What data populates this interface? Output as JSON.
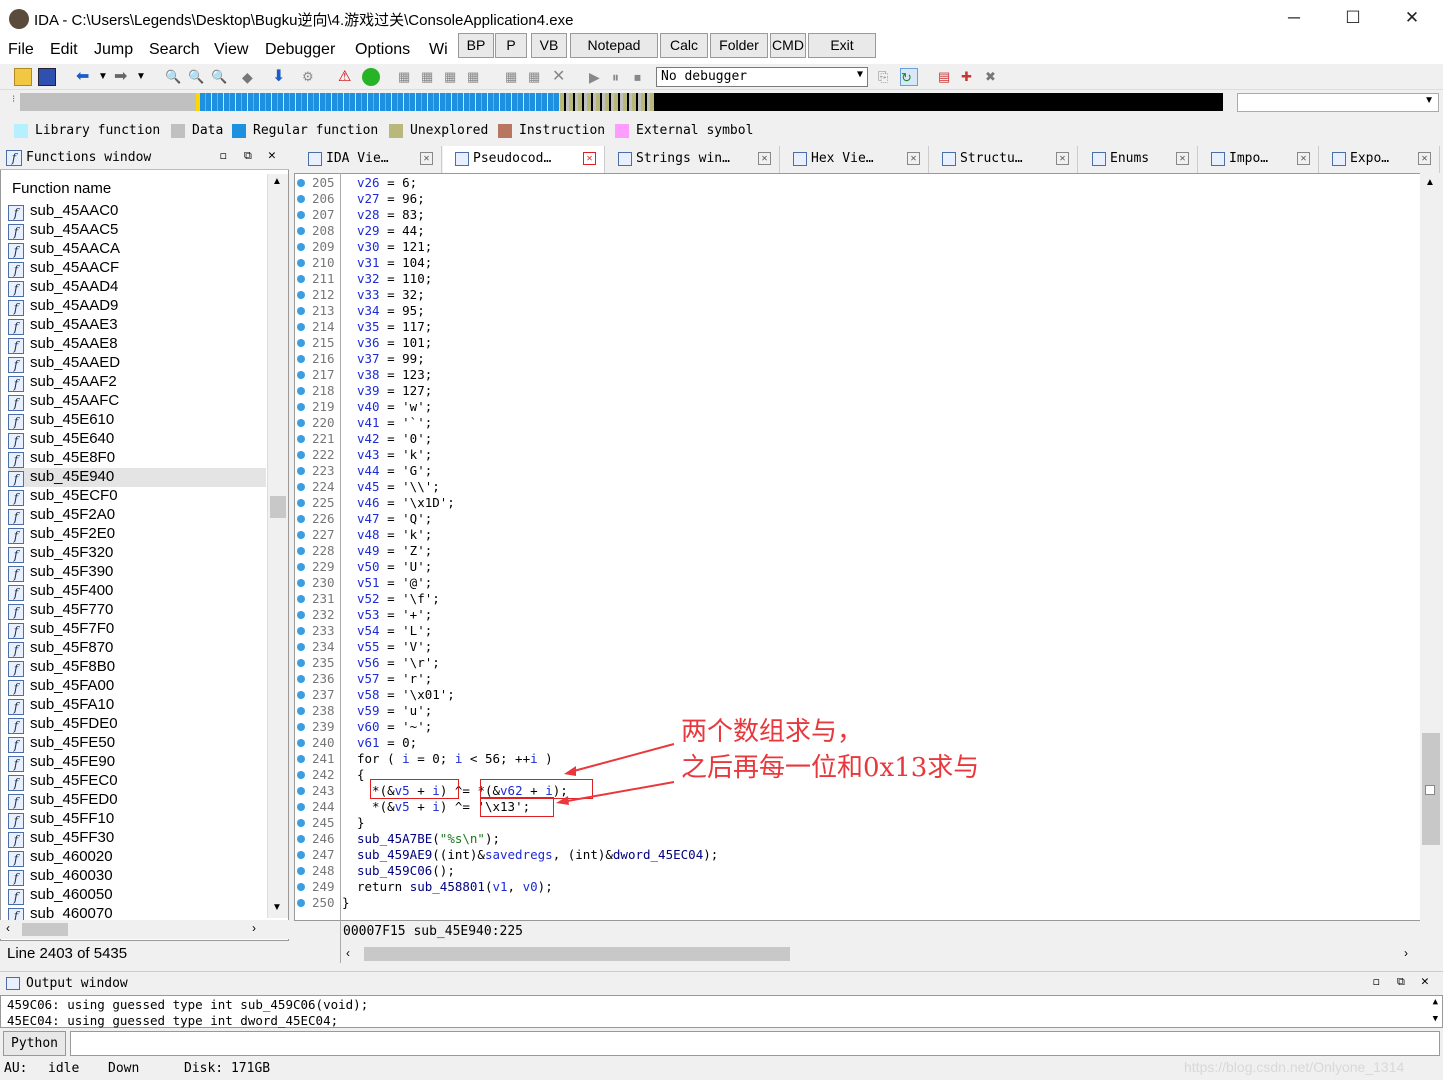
{
  "window": {
    "title": "IDA - C:\\Users\\Legends\\Desktop\\Bugku逆向\\4.游戏过关\\ConsoleApplication4.exe",
    "min": "─",
    "max": "☐",
    "close": "✕"
  },
  "menu": [
    "File",
    "Edit",
    "Jump",
    "Search",
    "View",
    "Debugger",
    "Options",
    "Wi"
  ],
  "quick_buttons": [
    "BP",
    "P",
    "VB",
    "Notepad",
    "Calc",
    "Folder",
    "CMD",
    "Exit"
  ],
  "debugger_select": "No debugger",
  "legend": [
    {
      "label": "Library function",
      "color": "#b6f0ff"
    },
    {
      "label": "Data",
      "color": "#c0c0c0"
    },
    {
      "label": "Regular function",
      "color": "#1e90e0"
    },
    {
      "label": "Unexplored",
      "color": "#b8b87a"
    },
    {
      "label": "Instruction",
      "color": "#b87560"
    },
    {
      "label": "External symbol",
      "color": "#ff9cff"
    }
  ],
  "functions_window": {
    "title": "Functions window",
    "column": "Function name",
    "items": [
      "sub_45AAC0",
      "sub_45AAC5",
      "sub_45AACA",
      "sub_45AACF",
      "sub_45AAD4",
      "sub_45AAD9",
      "sub_45AAE3",
      "sub_45AAE8",
      "sub_45AAED",
      "sub_45AAF2",
      "sub_45AAFC",
      "sub_45E610",
      "sub_45E640",
      "sub_45E8F0",
      "sub_45E940",
      "sub_45ECF0",
      "sub_45F2A0",
      "sub_45F2E0",
      "sub_45F320",
      "sub_45F390",
      "sub_45F400",
      "sub_45F770",
      "sub_45F7F0",
      "sub_45F870",
      "sub_45F8B0",
      "sub_45FA00",
      "sub_45FA10",
      "sub_45FDE0",
      "sub_45FE50",
      "sub_45FE90",
      "sub_45FEC0",
      "sub_45FED0",
      "sub_45FF10",
      "sub_45FF30",
      "sub_460020",
      "sub_460030",
      "sub_460050",
      "sub_460070"
    ],
    "selected": "sub_45E940",
    "line_status": "Line 2403 of 5435"
  },
  "tabs": [
    {
      "label": "IDA Vie…",
      "icon": "ida-view-icon"
    },
    {
      "label": "Pseudocod…",
      "icon": "pseudocode-icon",
      "active": true
    },
    {
      "label": "Strings win…",
      "icon": "strings-icon"
    },
    {
      "label": "Hex Vie…",
      "icon": "hex-icon"
    },
    {
      "label": "Structu…",
      "icon": "struct-icon"
    },
    {
      "label": "Enums",
      "icon": "enums-icon"
    },
    {
      "label": "Impo…",
      "icon": "imports-icon"
    },
    {
      "label": "Expo…",
      "icon": "exports-icon"
    }
  ],
  "code": [
    {
      "n": "205",
      "t": "v26 = 6;"
    },
    {
      "n": "206",
      "t": "v27 = 96;"
    },
    {
      "n": "207",
      "t": "v28 = 83;"
    },
    {
      "n": "208",
      "t": "v29 = 44;"
    },
    {
      "n": "209",
      "t": "v30 = 121;"
    },
    {
      "n": "210",
      "t": "v31 = 104;"
    },
    {
      "n": "211",
      "t": "v32 = 110;"
    },
    {
      "n": "212",
      "t": "v33 = 32;"
    },
    {
      "n": "213",
      "t": "v34 = 95;"
    },
    {
      "n": "214",
      "t": "v35 = 117;"
    },
    {
      "n": "215",
      "t": "v36 = 101;"
    },
    {
      "n": "216",
      "t": "v37 = 99;"
    },
    {
      "n": "217",
      "t": "v38 = 123;"
    },
    {
      "n": "218",
      "t": "v39 = 127;"
    },
    {
      "n": "219",
      "t": "v40 = 'w';"
    },
    {
      "n": "220",
      "t": "v41 = '`';"
    },
    {
      "n": "221",
      "t": "v42 = '0';"
    },
    {
      "n": "222",
      "t": "v43 = 'k';"
    },
    {
      "n": "223",
      "t": "v44 = 'G';"
    },
    {
      "n": "224",
      "t": "v45 = '\\\\';"
    },
    {
      "n": "225",
      "t": "v46 = '\\x1D';"
    },
    {
      "n": "226",
      "t": "v47 = 'Q';"
    },
    {
      "n": "227",
      "t": "v48 = 'k';"
    },
    {
      "n": "228",
      "t": "v49 = 'Z';"
    },
    {
      "n": "229",
      "t": "v50 = 'U';"
    },
    {
      "n": "230",
      "t": "v51 = '@';"
    },
    {
      "n": "231",
      "t": "v52 = '\\f';"
    },
    {
      "n": "232",
      "t": "v53 = '+';"
    },
    {
      "n": "233",
      "t": "v54 = 'L';"
    },
    {
      "n": "234",
      "t": "v55 = 'V';"
    },
    {
      "n": "235",
      "t": "v56 = '\\r';"
    },
    {
      "n": "236",
      "t": "v57 = 'r';"
    },
    {
      "n": "237",
      "t": "v58 = '\\x01';"
    },
    {
      "n": "238",
      "t": "v59 = 'u';"
    },
    {
      "n": "239",
      "t": "v60 = '~';"
    },
    {
      "n": "240",
      "t": "v61 = 0;"
    },
    {
      "n": "241",
      "t": "for ( i = 0; i < 56; ++i )"
    },
    {
      "n": "242",
      "t": "{"
    },
    {
      "n": "243",
      "t": "  *(&v5 + i) ^= *(&v62 + i);"
    },
    {
      "n": "244",
      "t": "  *(&v5 + i) ^= '\\x13';"
    },
    {
      "n": "245",
      "t": "}"
    },
    {
      "n": "246",
      "t": "sub_45A7BE(\"%s\\n\");"
    },
    {
      "n": "247",
      "t": "sub_459AE9((int)&savedregs, (int)&dword_45EC04);"
    },
    {
      "n": "248",
      "t": "sub_459C06();"
    },
    {
      "n": "249",
      "t": "return sub_458801(v1, v0);"
    },
    {
      "n": "250",
      "t": "}"
    }
  ],
  "address_bar": "00007F15 sub_45E940:225",
  "annotation": {
    "line1": "两个数组求与，",
    "line2": "之后再每一位和0x13求与"
  },
  "output": {
    "title": "Output window",
    "lines": [
      "459C06: using guessed type int sub_459C06(void);",
      "45EC04: using guessed type int dword_45EC04;"
    ]
  },
  "python_button": "Python",
  "status": {
    "au": "AU:",
    "state": "idle",
    "dir": "Down",
    "disk": "Disk: 171GB"
  },
  "watermark": "https://blog.csdn.net/Onlyone_1314"
}
